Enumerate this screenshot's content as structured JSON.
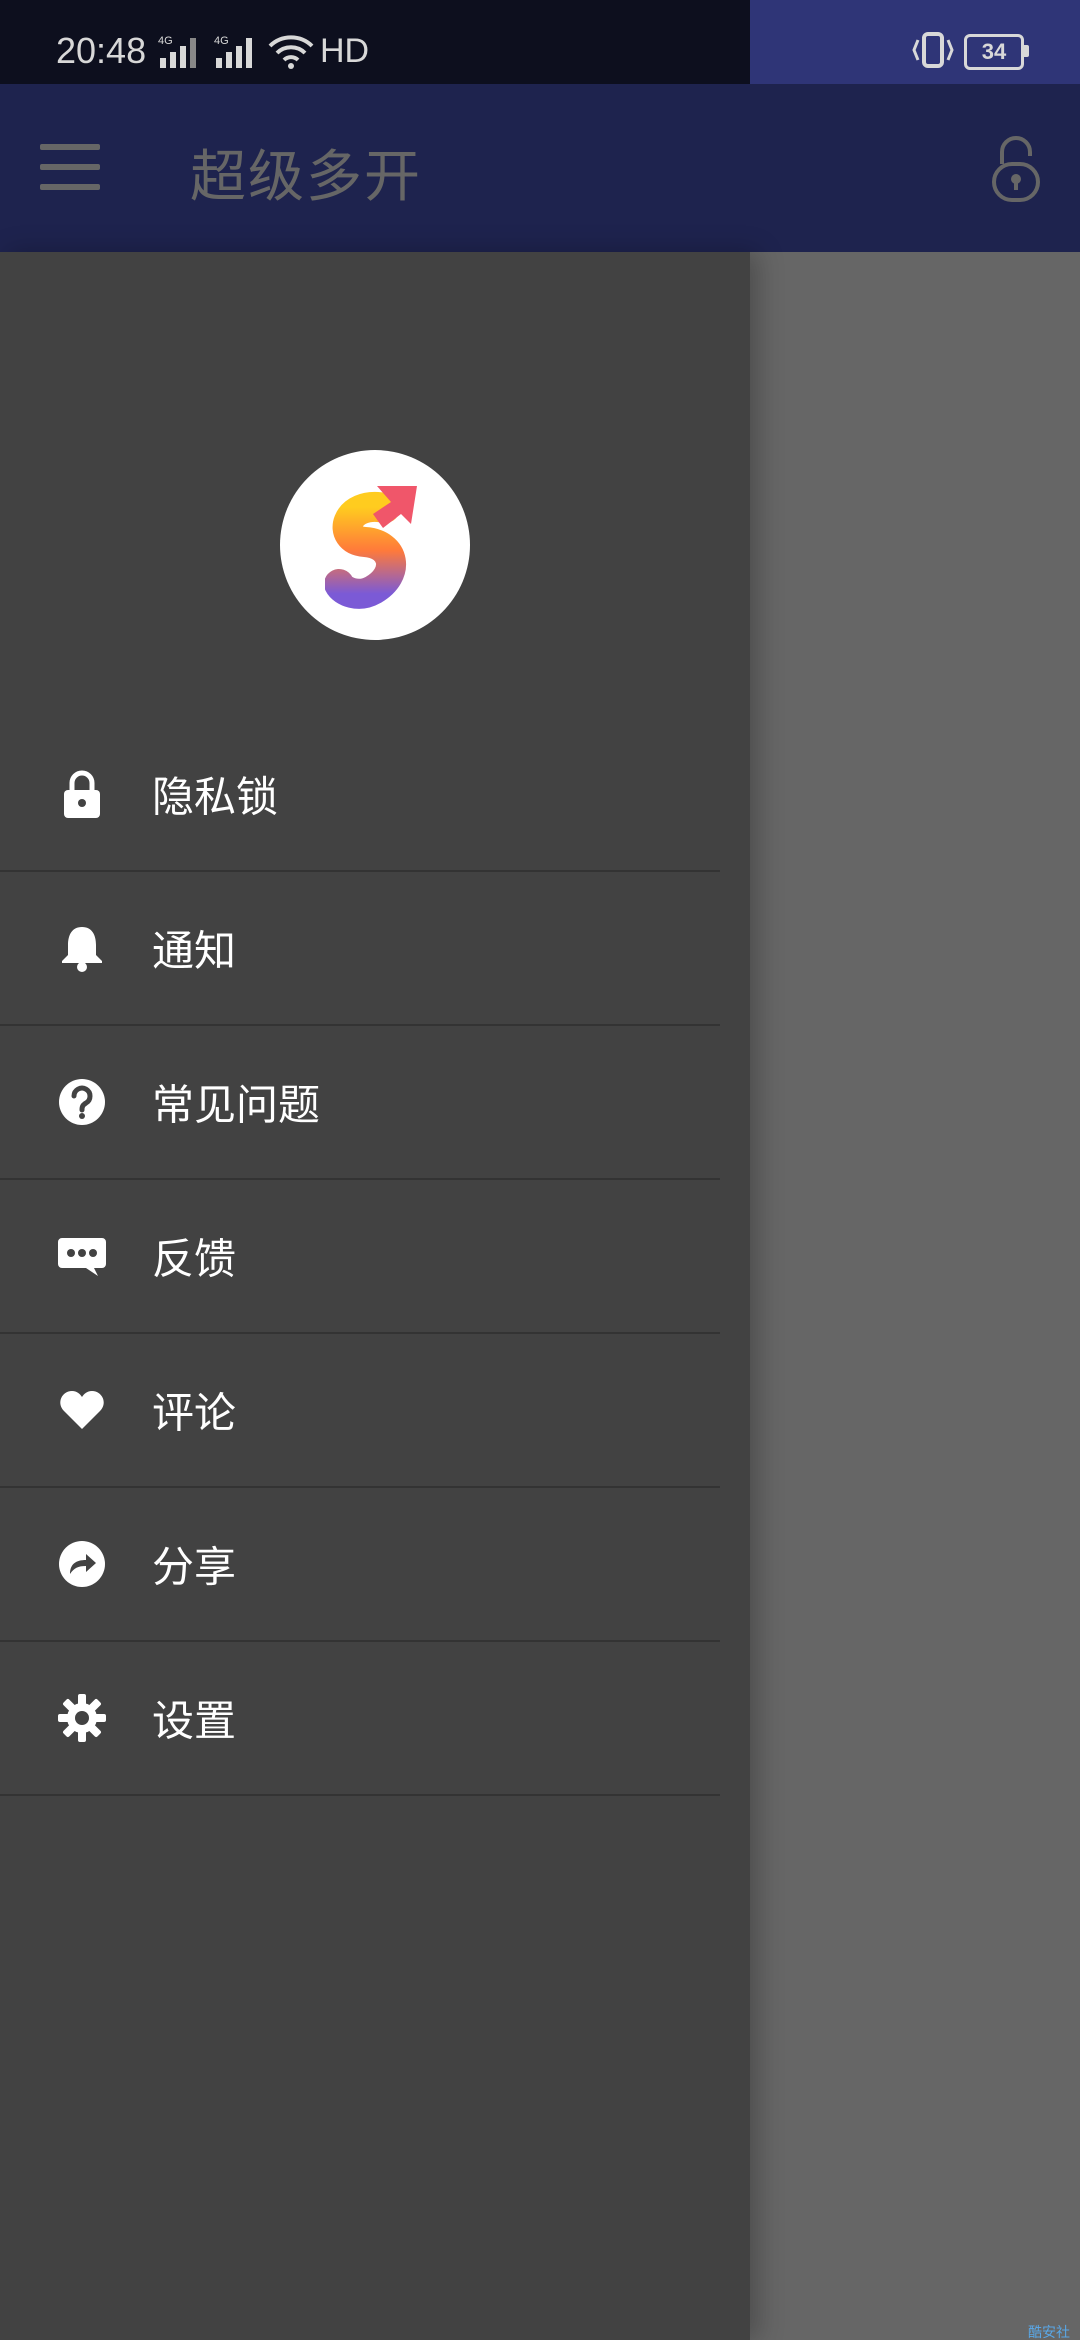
{
  "status_bar": {
    "time": "20:48",
    "network_1": "4G",
    "network_2": "4G",
    "hd_label": "HD",
    "battery_level": "34"
  },
  "app_bar": {
    "title": "超级多开",
    "lock_icon": "unlock-icon",
    "menu_icon": "hamburger-icon",
    "color": "#4c58c3"
  },
  "drawer": {
    "logo_icon": "app-logo-s-icon",
    "items": [
      {
        "label": "隐私锁",
        "icon": "lock-icon"
      },
      {
        "label": "通知",
        "icon": "bell-icon"
      },
      {
        "label": "常见问题",
        "icon": "help-icon"
      },
      {
        "label": "反馈",
        "icon": "chat-bubble-icon"
      },
      {
        "label": "评论",
        "icon": "heart-icon"
      },
      {
        "label": "分享",
        "icon": "share-icon"
      },
      {
        "label": "设置",
        "icon": "gear-icon"
      }
    ],
    "background": "#424242"
  },
  "fab": {
    "icon": "plus-icon",
    "color": "#e3580f"
  },
  "watermark": "酷安社区"
}
